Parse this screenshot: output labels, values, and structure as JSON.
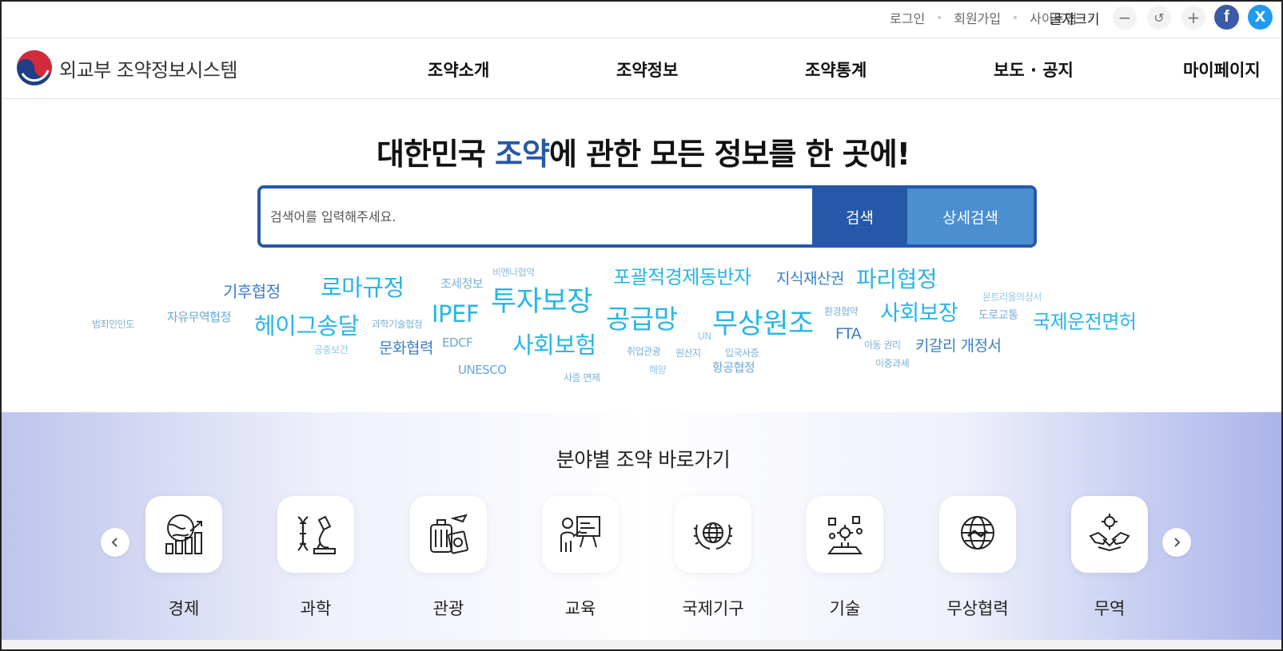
{
  "util": {
    "login": "로그인",
    "signup": "회원가입",
    "sitemap": "사이트맵",
    "font_size_label": "글자크기",
    "decrease": "−",
    "reset": "↺",
    "increase": "+",
    "facebook": "f",
    "twitter": "X"
  },
  "header": {
    "logo_text": "외교부 조약정보시스템",
    "nav": [
      "조약소개",
      "조약정보",
      "조약통계",
      "보도 · 공지",
      "마이페이지"
    ]
  },
  "hero": {
    "title_pre": "대한민국 ",
    "title_hl": "조약",
    "title_post": "에 관한 모든 정보를 한 곳에!",
    "highlight_color": "#2658a9"
  },
  "search": {
    "placeholder": "검색어를 입력해주세요.",
    "search_label": "검색",
    "advanced_label": "상세검색"
  },
  "keywords": [
    {
      "text": "기후협정"
    },
    {
      "text": "로마규정"
    },
    {
      "text": "조세정보"
    },
    {
      "text": "비엔나협약"
    },
    {
      "text": "포괄적경제동반자"
    },
    {
      "text": "지식재산권"
    },
    {
      "text": "파리협정"
    },
    {
      "text": "몬트리올의정서"
    },
    {
      "text": "범죄인인도"
    },
    {
      "text": "자유무역협정"
    },
    {
      "text": "헤이그송달"
    },
    {
      "text": "과학기술협정"
    },
    {
      "text": "IPEF"
    },
    {
      "text": "투자보장"
    },
    {
      "text": "공급망"
    },
    {
      "text": "무상원조"
    },
    {
      "text": "환경협약"
    },
    {
      "text": "사회보장"
    },
    {
      "text": "도로교통"
    },
    {
      "text": "국제운전면허"
    },
    {
      "text": "공중보건"
    },
    {
      "text": "문화협력"
    },
    {
      "text": "EDCF"
    },
    {
      "text": "사회보험"
    },
    {
      "text": "취업관광"
    },
    {
      "text": "원산지"
    },
    {
      "text": "UN"
    },
    {
      "text": "입국사증"
    },
    {
      "text": "FTA"
    },
    {
      "text": "아동 권리"
    },
    {
      "text": "키갈리 개정서"
    },
    {
      "text": "UNESCO"
    },
    {
      "text": "사증 면제"
    },
    {
      "text": "해양"
    },
    {
      "text": "항공협정"
    },
    {
      "text": "이중과세"
    }
  ],
  "categories": {
    "title": "분야별 조약 바로가기",
    "items": [
      {
        "label": "경제",
        "icon": "economy-icon"
      },
      {
        "label": "과학",
        "icon": "science-icon"
      },
      {
        "label": "관광",
        "icon": "tourism-icon"
      },
      {
        "label": "교육",
        "icon": "education-icon"
      },
      {
        "label": "국제기구",
        "icon": "international-organization-icon"
      },
      {
        "label": "기술",
        "icon": "technology-icon"
      },
      {
        "label": "무상협력",
        "icon": "grant-cooperation-icon"
      },
      {
        "label": "무역",
        "icon": "trade-icon"
      }
    ]
  }
}
